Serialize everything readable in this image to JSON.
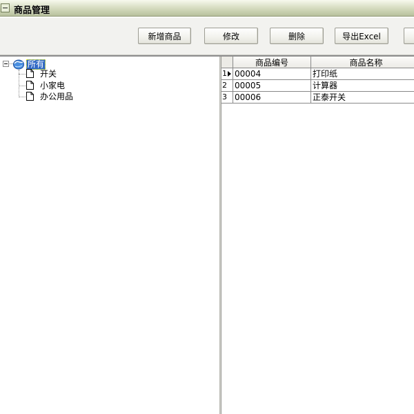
{
  "window": {
    "title": "商品管理",
    "icon": "minimize-box-icon"
  },
  "toolbar": {
    "add_label": "新增商品",
    "edit_label": "修改",
    "delete_label": "删除",
    "export_label": "导出Excel",
    "extra_label": ""
  },
  "tree": {
    "root": {
      "label": "所有",
      "icon": "globe-icon",
      "expanded": true,
      "selected": true
    },
    "children": [
      {
        "label": "开关",
        "icon": "page-icon"
      },
      {
        "label": "小家电",
        "icon": "page-icon"
      },
      {
        "label": "办公用品",
        "icon": "page-icon"
      }
    ]
  },
  "grid": {
    "columns": [
      "商品编号",
      "商品名称"
    ],
    "rows": [
      {
        "num": "1",
        "code": "00004",
        "name": "打印纸",
        "current": true
      },
      {
        "num": "2",
        "code": "00005",
        "name": "计算器",
        "current": false
      },
      {
        "num": "3",
        "code": "00006",
        "name": "正泰开关",
        "current": false
      }
    ]
  },
  "colors": {
    "title_bar": "#d9dfc4",
    "selection": "#3169c6",
    "grid_line": "#888888"
  }
}
